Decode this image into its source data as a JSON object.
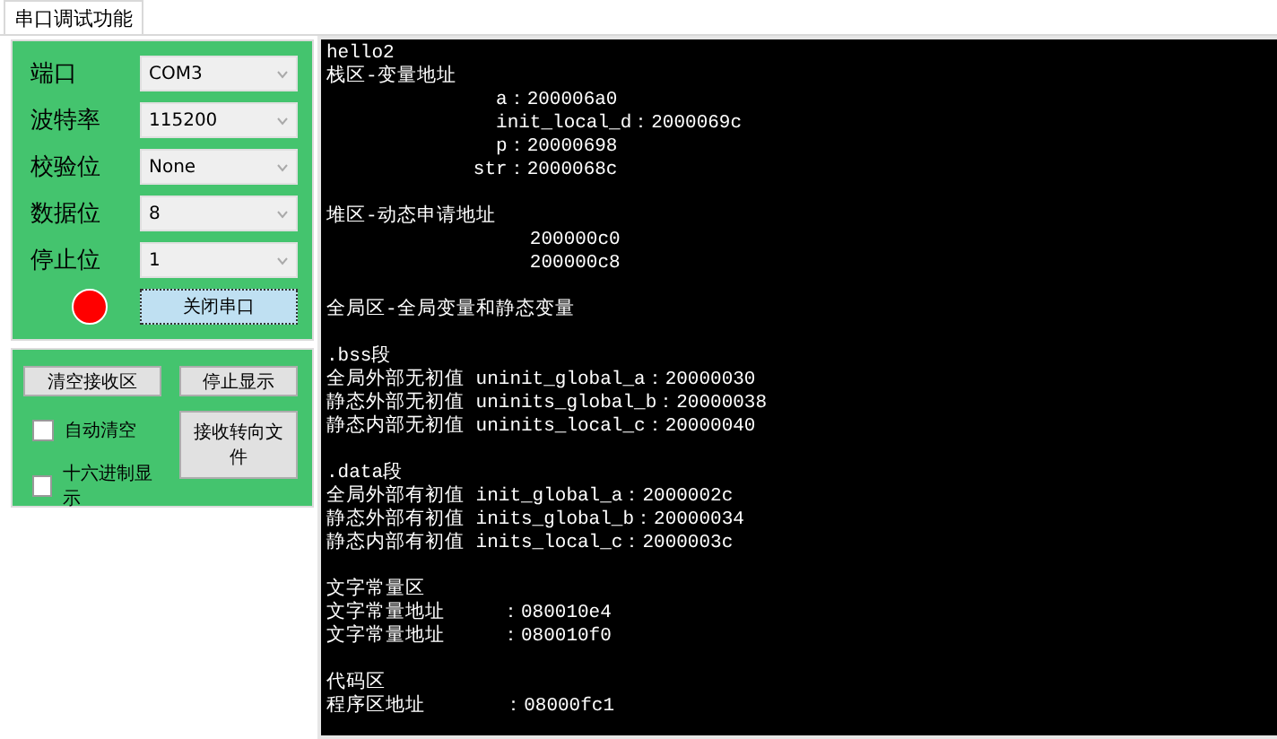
{
  "tabs": [
    {
      "label": "串口调试功能",
      "selected": true
    }
  ],
  "settings": [
    {
      "label": "端口",
      "value": "COM3"
    },
    {
      "label": "波特率",
      "value": "115200"
    },
    {
      "label": "校验位",
      "value": "None"
    },
    {
      "label": "数据位",
      "value": "8"
    },
    {
      "label": "停止位",
      "value": "1"
    }
  ],
  "port_open": true,
  "port_button": "关闭串口",
  "receive": {
    "clear_button": "清空接收区",
    "stop_button": "停止显示",
    "file_button": "接收转向文件",
    "options": [
      {
        "label": "自动清空",
        "checked": false
      },
      {
        "label": "十六进制显示",
        "checked": false
      }
    ]
  },
  "terminal": [
    [
      "hello2",
      "栈区-变量地址",
      "               a：200006a0",
      "               init_local_d：2000069c",
      "               p：20000698",
      "             str：2000068c"
    ],
    [
      "堆区-动态申请地址",
      "                  200000c0",
      "                  200000c8"
    ],
    [
      "全局区-全局变量和静态变量"
    ],
    [
      ".bss段",
      "全局外部无初值 uninit_global_a：20000030",
      "静态外部无初值 uninits_global_b：20000038",
      "静态内部无初值 uninits_local_c：20000040"
    ],
    [
      ".data段",
      "全局外部有初值 init_global_a：2000002c",
      "静态外部有初值 inits_global_b：20000034",
      "静态内部有初值 inits_local_c：2000003c"
    ],
    [
      "文字常量区",
      "文字常量地址     ：080010e4",
      "文字常量地址     ：080010f0"
    ],
    [
      "代码区",
      "程序区地址       ：08000fc1"
    ]
  ]
}
